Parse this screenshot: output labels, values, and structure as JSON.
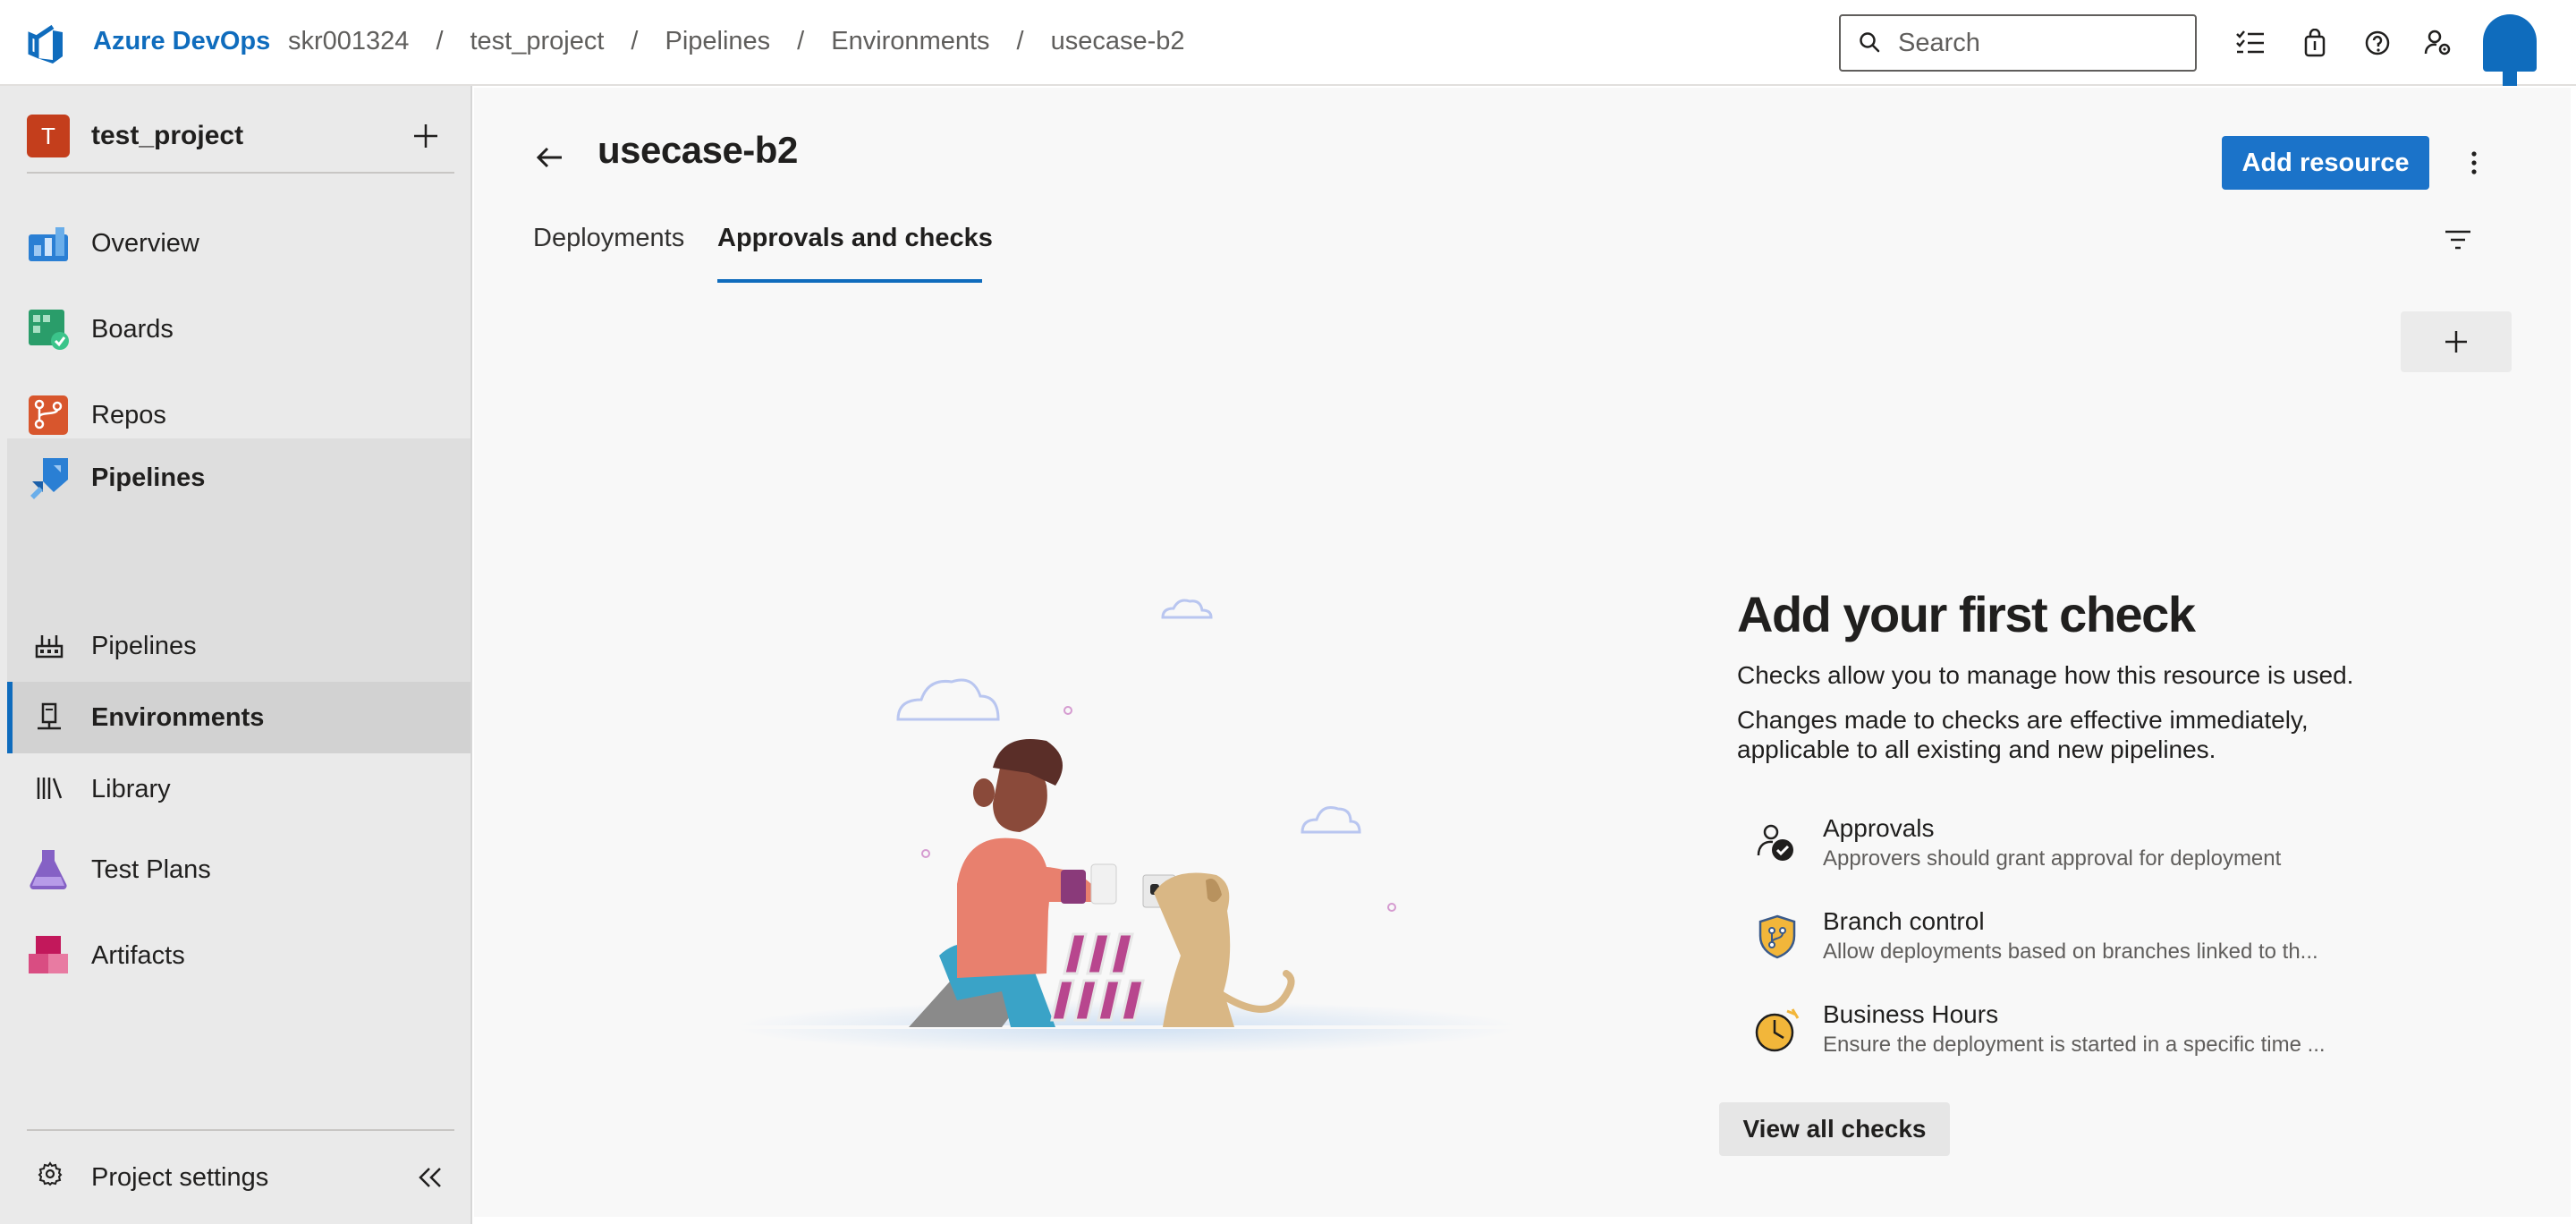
{
  "topbar": {
    "brand": "Azure DevOps",
    "breadcrumbs": [
      "skr001324",
      "test_project",
      "Pipelines",
      "Environments",
      "usecase-b2"
    ],
    "separator": "/",
    "search_placeholder": "Search",
    "icons": [
      "search-icon",
      "task-list-icon",
      "shopping-bag-icon",
      "help-icon",
      "user-settings-icon"
    ],
    "accent_color": "#0f6cbd"
  },
  "sidebar": {
    "project_initial": "T",
    "project_name": "test_project",
    "project_avatar_color": "#c43e1c",
    "items": [
      {
        "label": "Overview",
        "icon": "overview-icon"
      },
      {
        "label": "Boards",
        "icon": "boards-icon"
      },
      {
        "label": "Repos",
        "icon": "repos-icon"
      },
      {
        "label": "Pipelines",
        "icon": "pipelines-icon"
      },
      {
        "label": "Pipelines",
        "icon": "pipelines-sub-icon"
      },
      {
        "label": "Environments",
        "icon": "environments-icon"
      },
      {
        "label": "Library",
        "icon": "library-icon"
      },
      {
        "label": "Test Plans",
        "icon": "test-plans-icon"
      },
      {
        "label": "Artifacts",
        "icon": "artifacts-icon"
      }
    ],
    "selected": "Environments",
    "settings_label": "Project settings"
  },
  "main": {
    "title": "usecase-b2",
    "add_resource_label": "Add resource",
    "tabs": [
      {
        "label": "Deployments",
        "active": false
      },
      {
        "label": "Approvals and checks",
        "active": true
      }
    ],
    "empty_state": {
      "title": "Add your first check",
      "line1": "Checks allow you to manage how this resource is used.",
      "line2": "Changes made to checks are effective immediately, applicable to all existing and new pipelines.",
      "checks": [
        {
          "name": "Approvals",
          "description": "Approvers should grant approval for deployment",
          "icon": "approvals-icon"
        },
        {
          "name": "Branch control",
          "description": "Allow deployments based on branches linked to th...",
          "icon": "branch-control-icon"
        },
        {
          "name": "Business Hours",
          "description": "Ensure the deployment is started in a specific time ...",
          "icon": "business-hours-icon"
        }
      ],
      "view_all_label": "View all checks"
    }
  }
}
